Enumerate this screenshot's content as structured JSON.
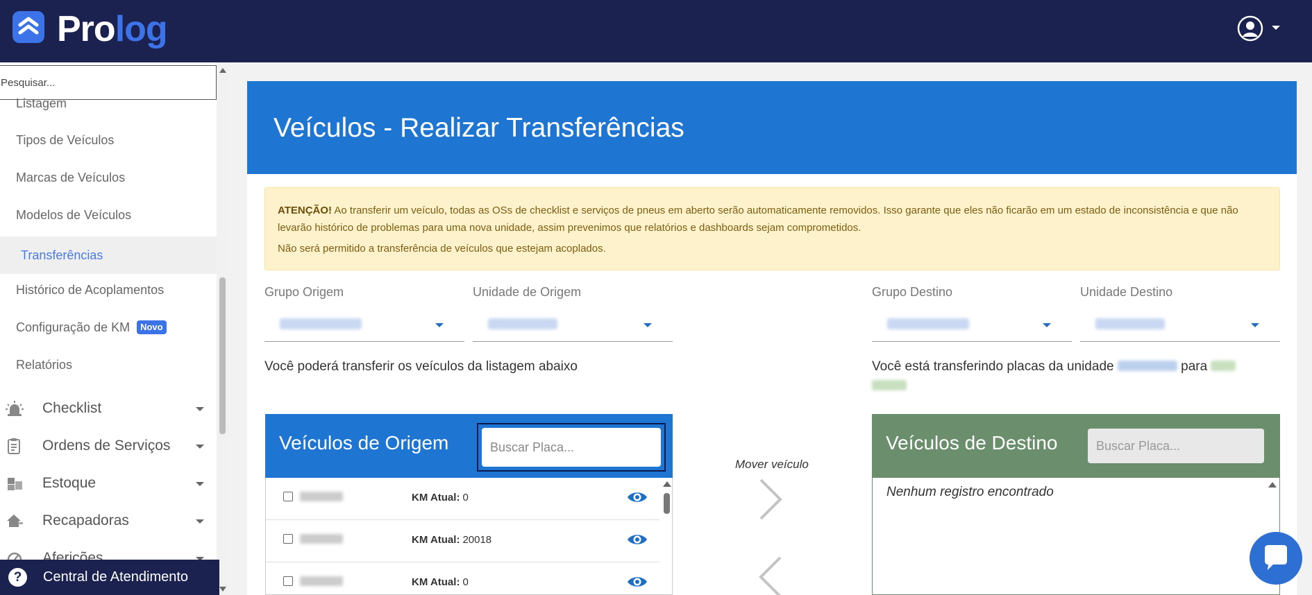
{
  "app": {
    "logo_text_primary": "Pro",
    "logo_text_accent": "log",
    "brand_color": "#1b2250",
    "accent_color": "#3d73e8"
  },
  "sidebar": {
    "search_placeholder": "Pesquisar...",
    "partial_item": "Listagem",
    "sub_items": [
      {
        "label": "Tipos de Veículos"
      },
      {
        "label": "Marcas de Veículos"
      },
      {
        "label": "Modelos de Veículos"
      },
      {
        "label": "Transferências",
        "active": true
      },
      {
        "label": "Histórico de Acoplamentos"
      },
      {
        "label": "Configuração de KM",
        "badge": "Novo"
      },
      {
        "label": "Relatórios"
      }
    ],
    "menu_items": [
      {
        "label": "Checklist",
        "icon": "alarm-light-icon"
      },
      {
        "label": "Ordens de Serviços",
        "icon": "clipboard-icon"
      },
      {
        "label": "Estoque",
        "icon": "boxes-icon"
      },
      {
        "label": "Recapadoras",
        "icon": "house-tools-icon"
      },
      {
        "label": "Aferições",
        "icon": "gauge-icon"
      }
    ],
    "central_label": "Central de Atendimento"
  },
  "page": {
    "title": "Veículos - Realizar Transferências",
    "header_color": "#1f76d2"
  },
  "alert": {
    "strong": "ATENÇÃO!",
    "text1": " Ao transferir um veículo, todas as OSs de checklist e serviços de pneus em aberto serão automaticamente removidos. Isso garante que eles não ficarão em um estado de inconsistência e que não levarão histórico de problemas para uma nova unidade, assim prevenimos que relatórios e dashboards sejam comprometidos.",
    "text2": "Não será permitido a transferência de veículos que estejam acoplados."
  },
  "filters": {
    "grupo_origem_label": "Grupo Origem",
    "unidade_origem_label": "Unidade de Origem",
    "grupo_destino_label": "Grupo Destino",
    "unidade_destino_label": "Unidade Destino"
  },
  "info": {
    "origin_text": "Você poderá transferir os veículos da listagem abaixo",
    "dest_text_prefix": "Você está transferindo placas da unidade",
    "dest_text_middle": "para"
  },
  "origin_panel": {
    "title": "Veículos de Origem",
    "search_placeholder": "Buscar Placa...",
    "km_label": "KM Atual:",
    "rows": [
      {
        "km": "0"
      },
      {
        "km": "20018"
      },
      {
        "km": "0"
      }
    ]
  },
  "move": {
    "label": "Mover veículo"
  },
  "dest_panel": {
    "title": "Veículos de Destino",
    "search_placeholder": "Buscar Placa...",
    "empty_message": "Nenhum registro encontrado",
    "header_color": "#6b8e6d"
  }
}
